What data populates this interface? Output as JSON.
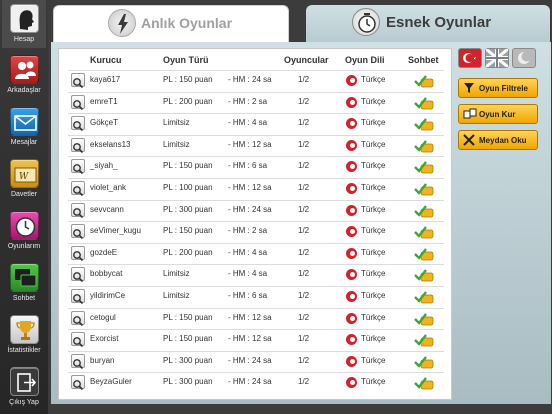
{
  "sidebar": {
    "items": [
      {
        "label": "Hesap",
        "icon": "user-head-icon",
        "color": "#f0f0f0",
        "active": true
      },
      {
        "label": "Arkadaşlar",
        "icon": "friends-icon",
        "color": "#c62a2a"
      },
      {
        "label": "Mesajlar",
        "icon": "envelope-icon",
        "color": "#1a7fc7"
      },
      {
        "label": "Davetler",
        "icon": "invitation-icon",
        "color": "#d4a020"
      },
      {
        "label": "Oyunlarım",
        "icon": "clock-icon",
        "color": "#c8258c"
      },
      {
        "label": "Sohbet",
        "icon": "chat-bubbles-icon",
        "color": "#3aaa35"
      },
      {
        "label": "İstatistikler",
        "icon": "trophy-icon",
        "color": "#d8d8d8"
      },
      {
        "label": "Çıkış Yap",
        "icon": "exit-icon",
        "color": "#3a3a3a"
      }
    ]
  },
  "tabs": {
    "left": {
      "label": "Anlık Oyunlar",
      "icon": "lightning-icon"
    },
    "right": {
      "label": "Esnek Oyunlar",
      "icon": "clock-icon"
    }
  },
  "table": {
    "headers": {
      "founder": "Kurucu",
      "type": "Oyun Türü",
      "players": "Oyuncular",
      "language": "Oyun Dili",
      "chat": "Sohbet"
    },
    "rows": [
      {
        "founder": "kaya617",
        "type": "PL : 150 puan",
        "time": "- HM : 24 sa",
        "players": "1/2",
        "language": "Türkçe"
      },
      {
        "founder": "emreT1",
        "type": "PL : 200 puan",
        "time": "- HM : 2 sa",
        "players": "1/2",
        "language": "Türkçe"
      },
      {
        "founder": "GökçeT",
        "type": "Limitsiz",
        "time": "- HM : 4 sa",
        "players": "1/2",
        "language": "Türkçe"
      },
      {
        "founder": "ekselans13",
        "type": "Limitsiz",
        "time": "- HM : 12 sa",
        "players": "1/2",
        "language": "Türkçe"
      },
      {
        "founder": "_siyah_",
        "type": "PL : 150 puan",
        "time": "- HM : 6 sa",
        "players": "1/2",
        "language": "Türkçe"
      },
      {
        "founder": "violet_ank",
        "type": "PL : 100 puan",
        "time": "- HM : 12 sa",
        "players": "1/2",
        "language": "Türkçe"
      },
      {
        "founder": "sevvcann",
        "type": "PL : 300 puan",
        "time": "- HM : 24 sa",
        "players": "1/2",
        "language": "Türkçe"
      },
      {
        "founder": "seVimer_kugu",
        "type": "PL : 150 puan",
        "time": "- HM : 2 sa",
        "players": "1/2",
        "language": "Türkçe"
      },
      {
        "founder": "gozdeE",
        "type": "PL : 200 puan",
        "time": "- HM : 4 sa",
        "players": "1/2",
        "language": "Türkçe"
      },
      {
        "founder": "bobbycat",
        "type": "Limitsiz",
        "time": "- HM : 4 sa",
        "players": "1/2",
        "language": "Türkçe"
      },
      {
        "founder": "yildirimCe",
        "type": "Limitsiz",
        "time": "- HM : 6 sa",
        "players": "1/2",
        "language": "Türkçe"
      },
      {
        "founder": "cetogul",
        "type": "PL : 150 puan",
        "time": "- HM : 12 sa",
        "players": "1/2",
        "language": "Türkçe"
      },
      {
        "founder": "Exorcist",
        "type": "PL : 150 puan",
        "time": "- HM : 12 sa",
        "players": "1/2",
        "language": "Türkçe"
      },
      {
        "founder": "buryan",
        "type": "PL : 300 puan",
        "time": "- HM : 24 sa",
        "players": "1/2",
        "language": "Türkçe"
      },
      {
        "founder": "BeyzaGuler",
        "type": "PL : 300 puan",
        "time": "- HM : 24 sa",
        "players": "1/2",
        "language": "Türkçe"
      }
    ]
  },
  "right_panel": {
    "languages": [
      {
        "icon": "turkey-flag-icon",
        "color": "#d2232a"
      },
      {
        "icon": "uk-flag-icon",
        "color": "#9aa0a6"
      },
      {
        "icon": "moon-icon",
        "color": "#b9b9b9"
      }
    ],
    "actions": [
      {
        "label": "Oyun Filtrele",
        "icon": "filter-icon"
      },
      {
        "label": "Oyun Kur",
        "icon": "tiles-icon"
      },
      {
        "label": "Meydan Oku",
        "icon": "crossed-swords-icon"
      }
    ]
  },
  "colors": {
    "accent": "#f0a500",
    "flag_red": "#d2232a",
    "chat_green": "#3aaa35"
  }
}
